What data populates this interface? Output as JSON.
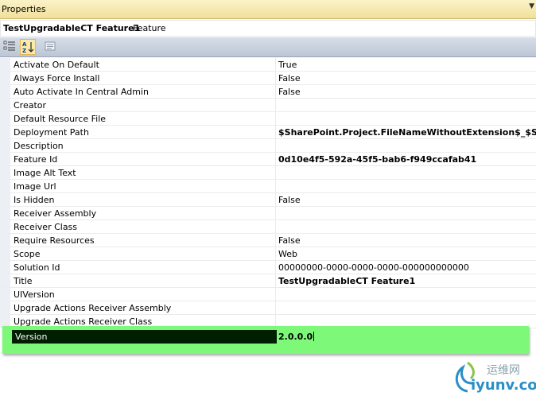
{
  "panel": {
    "title": "Properties"
  },
  "object": {
    "name": "TestUpgradableCT Feature1",
    "type": "Feature"
  },
  "properties": [
    {
      "name": "Activate On Default",
      "value": "True",
      "bold": false
    },
    {
      "name": "Always Force Install",
      "value": "False",
      "bold": false
    },
    {
      "name": "Auto Activate In Central Admin",
      "value": "False",
      "bold": false
    },
    {
      "name": "Creator",
      "value": "",
      "bold": false
    },
    {
      "name": "Default Resource File",
      "value": "",
      "bold": false
    },
    {
      "name": "Deployment Path",
      "value": "$SharePoint.Project.FileNameWithoutExtension$_$ShareP",
      "bold": true
    },
    {
      "name": "Description",
      "value": "",
      "bold": false
    },
    {
      "name": "Feature Id",
      "value": "0d10e4f5-592a-45f5-bab6-f949ccafab41",
      "bold": true
    },
    {
      "name": "Image Alt Text",
      "value": "",
      "bold": false
    },
    {
      "name": "Image Url",
      "value": "",
      "bold": false
    },
    {
      "name": "Is Hidden",
      "value": "False",
      "bold": false
    },
    {
      "name": "Receiver Assembly",
      "value": "",
      "bold": false
    },
    {
      "name": "Receiver Class",
      "value": "",
      "bold": false
    },
    {
      "name": "Require Resources",
      "value": "False",
      "bold": false
    },
    {
      "name": "Scope",
      "value": "Web",
      "bold": false
    },
    {
      "name": "Solution Id",
      "value": "00000000-0000-0000-0000-000000000000",
      "bold": false
    },
    {
      "name": "Title",
      "value": "TestUpgradableCT Feature1",
      "bold": true
    },
    {
      "name": "UIVersion",
      "value": "",
      "bold": false
    },
    {
      "name": "Upgrade Actions Receiver Assembly",
      "value": "",
      "bold": false
    },
    {
      "name": "Upgrade Actions Receiver Class",
      "value": "",
      "bold": false
    }
  ],
  "selected": {
    "name": "Version",
    "value": "2.0.0.0"
  },
  "watermark": {
    "line1": "运维网",
    "line2": "iyunv.com"
  },
  "colors": {
    "highlight": "#7ef879",
    "selected_row": "#001e00",
    "toolbar": "#c8d0dc"
  }
}
